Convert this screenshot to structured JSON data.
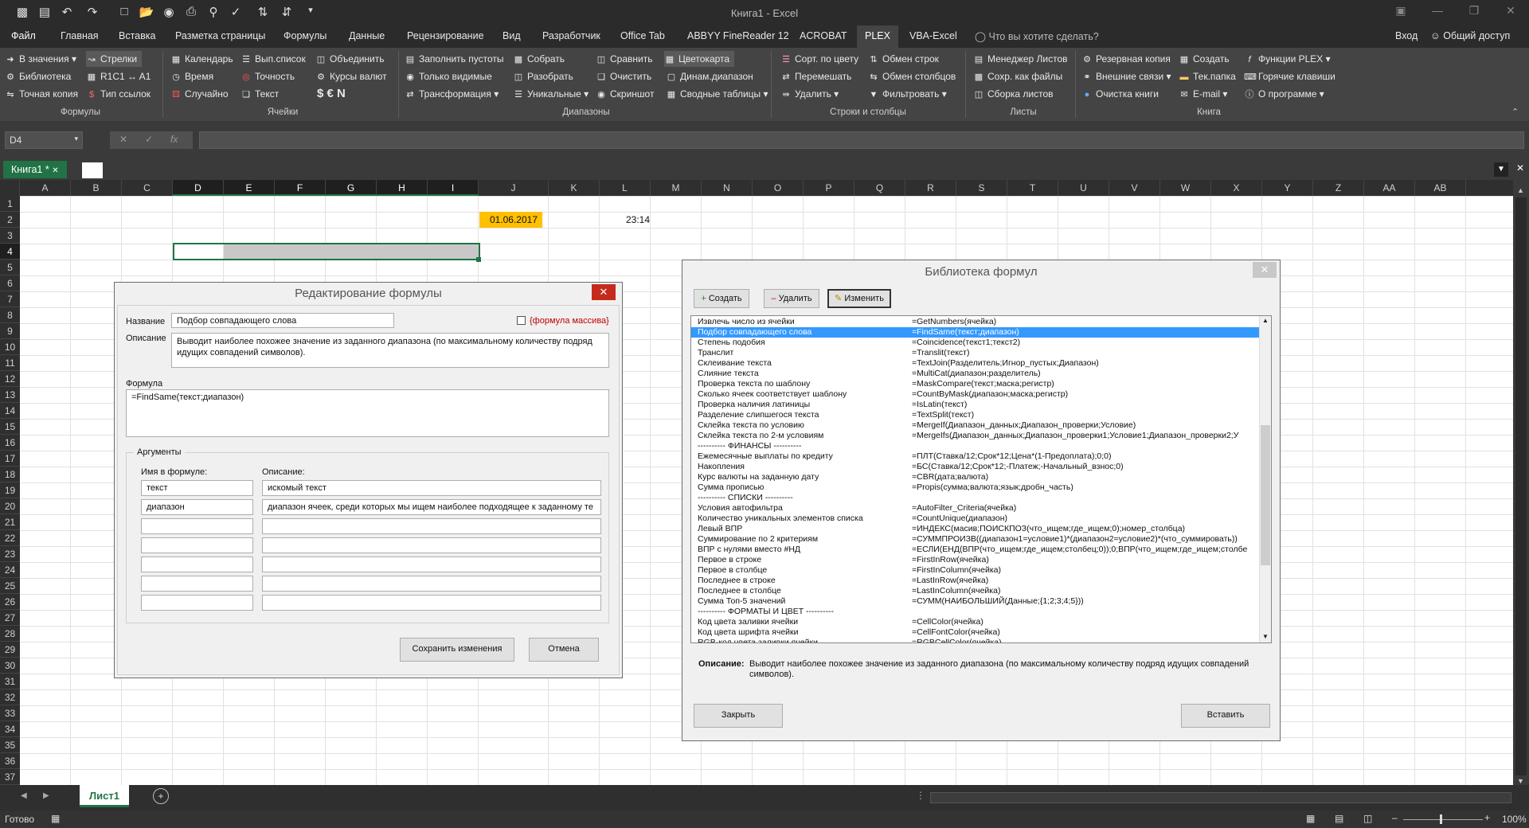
{
  "app": {
    "title": "Книга1 - Excel",
    "qat_icons": [
      "save-icon",
      "save-as-icon",
      "undo-icon",
      "redo-icon",
      "new-icon",
      "open-icon",
      "camera-icon",
      "print-icon",
      "print-preview-icon",
      "spelling-icon",
      "sort-asc-icon",
      "sort-desc-icon",
      "customize-icon"
    ],
    "signin": "Вход",
    "share": "Общий доступ",
    "tellme": "Что вы хотите сделать?"
  },
  "tabs": [
    "Файл",
    "Главная",
    "Вставка",
    "Разметка страницы",
    "Формулы",
    "Данные",
    "Рецензирование",
    "Вид",
    "Разработчик",
    "Office Tab",
    "ABBYY FineReader 12",
    "ACROBAT",
    "PLEX",
    "VBA-Excel"
  ],
  "active_tab": "PLEX",
  "ribbon": {
    "groups": {
      "formulas": "Формулы",
      "cells": "Ячейки",
      "ranges": "Диапазоны",
      "rowscols": "Строки и столбцы",
      "sheets": "Листы",
      "book": "Книга"
    },
    "buttons": {
      "b1": "В значения",
      "b2": "Библиотека",
      "b3": "Точная копия",
      "b4": "Стрелки",
      "b5": "R1C1 ↔ A1",
      "b6": "Тип ссылок",
      "b7": "Календарь",
      "b8": "Время",
      "b9": "Случайно",
      "b10": "Вып.список",
      "b11": "Точность",
      "b12": "Текст",
      "b13": "Объединить",
      "b14": "Курсы валют",
      "b15": "$  €  N",
      "b16": "Заполнить пустоты",
      "b17": "Только видимые",
      "b18": "Трансформация",
      "b19": "Собрать",
      "b20": "Разобрать",
      "b21": "Уникальные",
      "b22": "Сравнить",
      "b23": "Очистить",
      "b24": "Скриншот",
      "b25": "Цветокарта",
      "b26": "Динам.диапазон",
      "b27": "Сводные таблицы",
      "b28": "Сорт. по цвету",
      "b29": "Перемешать",
      "b30": "Удалить",
      "b31": "Обмен строк",
      "b32": "Обмен столбцов",
      "b33": "Фильтровать",
      "b34": "Менеджер Листов",
      "b35": "Сохр. как файлы",
      "b36": "Сборка листов",
      "b37": "Резервная копия",
      "b38": "Внешние связи",
      "b39": "Очистка книги",
      "b40": "Создать",
      "b41": "Тек.папка",
      "b42": "E-mail",
      "b43": "Функции PLEX",
      "b44": "Горячие клавиши",
      "b45": "О программе"
    }
  },
  "formula_bar": {
    "namebox": "D4",
    "fx": "fx",
    "value": ""
  },
  "workbook_tab": "Книга1 *",
  "columns": [
    "A",
    "B",
    "C",
    "D",
    "E",
    "F",
    "G",
    "H",
    "I",
    "J",
    "K",
    "L",
    "M",
    "N",
    "O",
    "P",
    "Q",
    "R",
    "S",
    "T",
    "U",
    "V",
    "W",
    "X",
    "Y",
    "Z",
    "AA",
    "AB",
    "AC"
  ],
  "rows": [
    "1",
    "2",
    "3",
    "4",
    "5",
    "6",
    "7",
    "8",
    "9",
    "10",
    "11",
    "12",
    "13",
    "14",
    "15",
    "16",
    "17",
    "18",
    "19",
    "20",
    "21",
    "22",
    "23",
    "24",
    "25",
    "26",
    "27",
    "28",
    "29",
    "30",
    "31",
    "32",
    "33",
    "34",
    "35",
    "36",
    "37"
  ],
  "cells": {
    "J2": "01.06.2017",
    "L2": "23:14"
  },
  "sheet_tab": "Лист1",
  "status": {
    "ready": "Готово",
    "zoom": "100%"
  },
  "edit_dialog": {
    "title": "Редактирование формулы",
    "name_label": "Название",
    "name_value": "Подбор совпадающего слова",
    "array_label": "{формула массива}",
    "desc_label": "Описание",
    "desc_value": "Выводит наиболее похожее значение из заданного диапазона (по максимальному количеству подряд идущих совпадений символов).",
    "formula_label": "Формула",
    "formula_value": "=FindSame(текст;диапазон)",
    "args_label": "Аргументы",
    "arg_name_header": "Имя в формуле:",
    "arg_desc_header": "Описание:",
    "args": [
      {
        "name": "текст",
        "desc": "искомый текст"
      },
      {
        "name": "диапазон",
        "desc": "диапазон ячеек, среди которых мы ищем наиболее подходящее к заданному те"
      },
      {
        "name": "",
        "desc": ""
      },
      {
        "name": "",
        "desc": ""
      },
      {
        "name": "",
        "desc": ""
      },
      {
        "name": "",
        "desc": ""
      },
      {
        "name": "",
        "desc": ""
      }
    ],
    "save_button": "Сохранить изменения",
    "cancel_button": "Отмена"
  },
  "library_dialog": {
    "title": "Библиотека формул",
    "create_button": "Создать",
    "delete_button": "Удалить",
    "edit_button": "Изменить",
    "items": [
      {
        "name": "Извлечь число из ячейки",
        "formula": "=GetNumbers(ячейка)"
      },
      {
        "name": "Подбор совпадающего слова",
        "formula": "=FindSame(текст;диапазон)",
        "selected": true
      },
      {
        "name": "Степень подобия",
        "formula": "=Coincidence(текст1;текст2)"
      },
      {
        "name": "Транслит",
        "formula": "=Translit(текст)"
      },
      {
        "name": "Склеивание текста",
        "formula": "=TextJoin(Разделитель;Игнор_пустых;Диапазон)"
      },
      {
        "name": "Слияние текста",
        "formula": "=MultiCat(диапазон;разделитель)"
      },
      {
        "name": "Проверка текста по шаблону",
        "formula": "=MaskCompare(текст;маска;регистр)"
      },
      {
        "name": "Сколько ячеек соответствует шаблону",
        "formula": "=CountByMask(диапазон;маска;регистр)"
      },
      {
        "name": "Проверка наличия латиницы",
        "formula": "=IsLatin(текст)"
      },
      {
        "name": "Разделение слипшегося текста",
        "formula": "=TextSplit(текст)"
      },
      {
        "name": "Склейка текста по условию",
        "formula": "=MergeIf(Диапазон_данных;Диапазон_проверки;Условие)"
      },
      {
        "name": "Склейка текста по 2-м условиям",
        "formula": "=MergeIfs(Диапазон_данных;Диапазон_проверки1;Условие1;Диапазон_проверки2;У"
      },
      {
        "name": "---------- ФИНАНСЫ ----------",
        "formula": ""
      },
      {
        "name": "Ежемесячные выплаты по кредиту",
        "formula": "=ПЛТ(Ставка/12;Срок*12;Цена*(1-Предоплата);0;0)"
      },
      {
        "name": "Накопления",
        "formula": "=БС(Ставка/12;Срок*12;-Платеж;-Начальный_взнос;0)"
      },
      {
        "name": "Курс валюты на заданную дату",
        "formula": "=CBR(дата;валюта)"
      },
      {
        "name": "Сумма прописью",
        "formula": "=Propis(сумма;валюта;язык;дробн_часть)"
      },
      {
        "name": "---------- СПИСКИ ----------",
        "formula": ""
      },
      {
        "name": "Условия автофильтра",
        "formula": "=AutoFilter_Criteria(ячейка)"
      },
      {
        "name": "Количество уникальных элементов списка",
        "formula": "=CountUnique(диапазон)"
      },
      {
        "name": "Левый ВПР",
        "formula": "=ИНДЕКС(масив;ПОИСКПОЗ(что_ищем;где_ищем;0);номер_столбца)"
      },
      {
        "name": "Суммирование по 2 критериям",
        "formula": "=СУММПРОИЗВ((диапазон1=условие1)*(диапазон2=условие2)*(что_суммировать))"
      },
      {
        "name": "ВПР с нулями вместо #НД",
        "formula": "=ЕСЛИ(ЕНД(ВПР(что_ищем;где_ищем;столбец;0));0;ВПР(что_ищем;где_ищем;столбе"
      },
      {
        "name": "Первое в строке",
        "formula": "=FirstInRow(ячейка)"
      },
      {
        "name": "Первое в столбце",
        "formula": "=FirstInColumn(ячейка)"
      },
      {
        "name": "Последнее в строке",
        "formula": "=LastInRow(ячейка)"
      },
      {
        "name": "Последнее в столбце",
        "formula": "=LastInColumn(ячейка)"
      },
      {
        "name": "Сумма Топ-5 значений",
        "formula": "=СУММ(НАИБОЛЬШИЙ(Данные;{1;2;3;4;5}))"
      },
      {
        "name": "---------- ФОРМАТЫ И ЦВЕТ ----------",
        "formula": ""
      },
      {
        "name": "Код цвета заливки ячейки",
        "formula": "=CellColor(ячейка)"
      },
      {
        "name": "Код цвета шрифта ячейки",
        "formula": "=CellFontColor(ячейка)"
      },
      {
        "name": "RGB-код цвета заливки ячейки",
        "formula": "=RGBCellColor(ячейка)"
      }
    ],
    "desc_label": "Описание:",
    "desc_value": "Выводит наиболее похожее значение из заданного диапазона (по максимальному количеству подряд идущих совпадений символов).",
    "close_button": "Закрыть",
    "insert_button": "Вставить"
  },
  "colors": {
    "excel_green": "#217346",
    "selection_blue": "#3399ff",
    "date_cell_fill": "#ffc000",
    "array_label_red": "#c00000"
  }
}
